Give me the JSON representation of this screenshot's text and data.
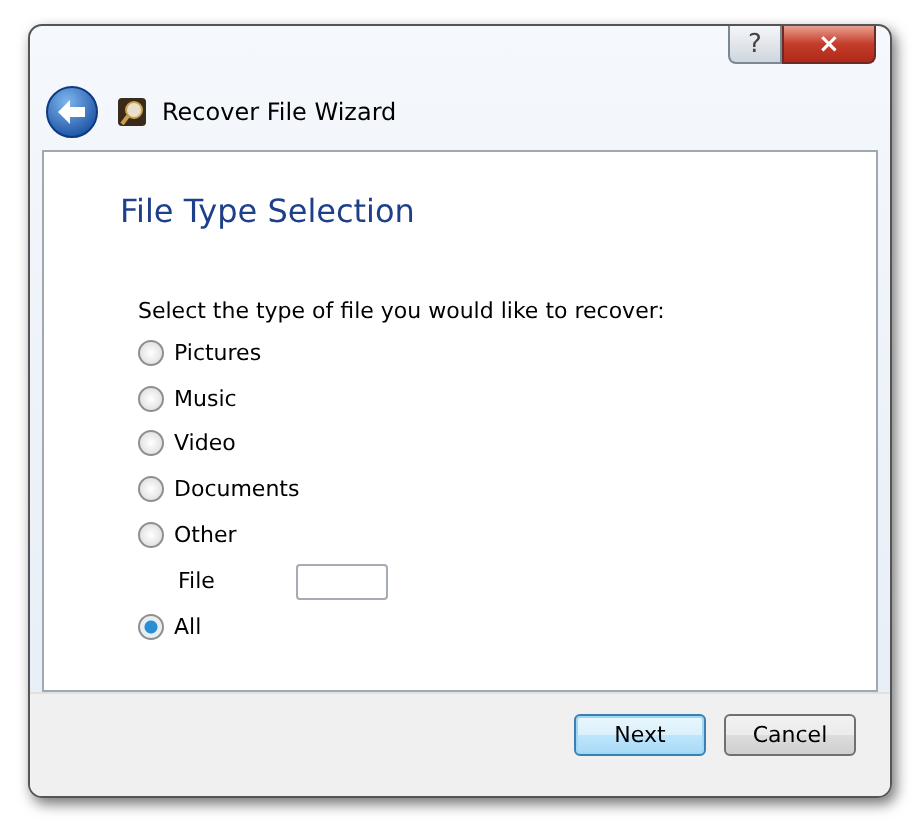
{
  "window": {
    "title": "Recover File Wizard",
    "caption_buttons": [
      "?",
      "×"
    ]
  },
  "heading": "File Type Selection",
  "prompt": "Select the type of file you would like to recover:",
  "options": [
    {
      "kind": "radio",
      "label": "Pictures",
      "selected": false
    },
    {
      "kind": "radio",
      "label": "Music",
      "selected": false
    },
    {
      "kind": "radio",
      "label": "Video",
      "selected": false
    },
    {
      "kind": "radio",
      "label": "Documents",
      "selected": false
    },
    {
      "kind": "radio",
      "label": "Other",
      "selected": false
    },
    {
      "kind": "field",
      "label": "File"
    },
    {
      "kind": "radio",
      "label": "All",
      "selected": true
    }
  ],
  "buttons": [
    {
      "label": "Next",
      "default": true
    },
    {
      "label": "Cancel",
      "default": false
    }
  ]
}
